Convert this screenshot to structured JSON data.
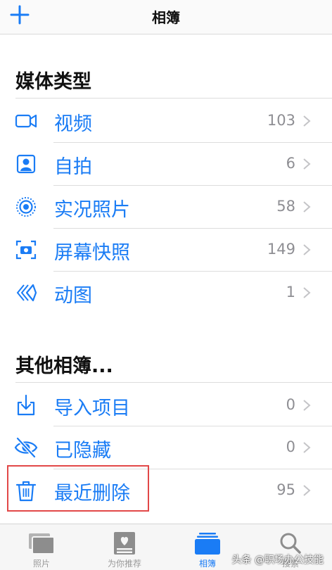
{
  "nav": {
    "title": "相簿"
  },
  "sections": {
    "media_types": "媒体类型",
    "other_albums": "其他相簿..."
  },
  "media_items": [
    {
      "label": "视频",
      "count": "103",
      "icon": "video-camera-icon"
    },
    {
      "label": "自拍",
      "count": "6",
      "icon": "portrait-icon"
    },
    {
      "label": "实况照片",
      "count": "58",
      "icon": "live-photo-icon"
    },
    {
      "label": "屏幕快照",
      "count": "149",
      "icon": "screenshot-icon"
    },
    {
      "label": "动图",
      "count": "1",
      "icon": "animated-icon"
    }
  ],
  "other_items": [
    {
      "label": "导入项目",
      "count": "0",
      "icon": "import-icon"
    },
    {
      "label": "已隐藏",
      "count": "0",
      "icon": "hidden-eye-icon"
    },
    {
      "label": "最近删除",
      "count": "95",
      "icon": "trash-icon"
    }
  ],
  "tabs": [
    {
      "label": "照片",
      "icon": "photos-icon"
    },
    {
      "label": "为你推荐",
      "icon": "for-you-icon"
    },
    {
      "label": "相簿",
      "icon": "albums-icon",
      "active": true
    },
    {
      "label": "搜索",
      "icon": "search-icon"
    }
  ],
  "watermark": "头条 @职场办公技能",
  "colors": {
    "accent": "#1a7cf5",
    "count": "#8e8e93",
    "highlight": "#e24848"
  }
}
